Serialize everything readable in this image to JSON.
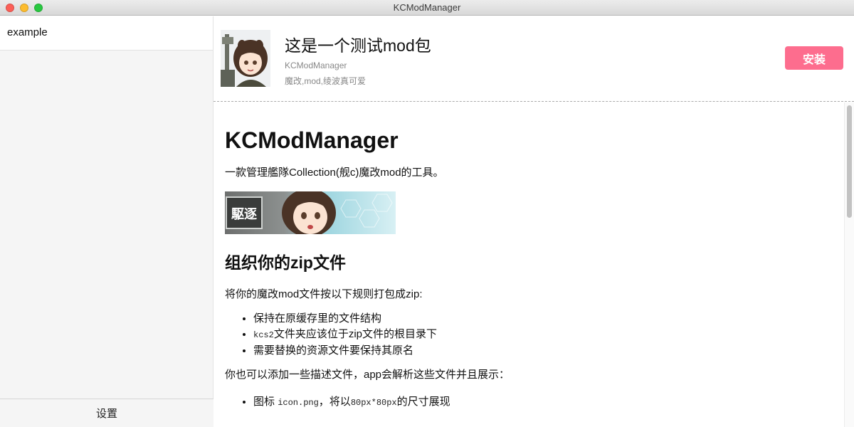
{
  "window": {
    "title": "KCModManager"
  },
  "sidebar": {
    "items": [
      {
        "label": "example"
      }
    ],
    "footer_label": "设置"
  },
  "mod": {
    "title": "这是一个测试mod包",
    "author": "KCModManager",
    "tags": "魔改,mod,绫波真可爱",
    "install_label": "安装",
    "install_color": "#fd6d8e"
  },
  "doc": {
    "h1": "KCModManager",
    "intro": "一款管理艦隊Collection(舰c)魔改mod的工具。",
    "banner_badge": "駆逐",
    "h2": "组织你的zip文件",
    "p_organize": "将你的魔改mod文件按以下规则打包成zip:",
    "rules": {
      "r1": "保持在原缓存里的文件结构",
      "r2_code": "kcs2",
      "r2_text": "文件夹应该位于zip文件的根目录下",
      "r3": "需要替换的资源文件要保持其原名"
    },
    "p_desc": "你也可以添加一些描述文件，app会解析这些文件并且展示：",
    "desc_items": {
      "d1_prefix": "图标",
      "d1_code1": "icon.png",
      "d1_mid": "，将以",
      "d1_code2": "80px*80px",
      "d1_suffix": "的尺寸展现"
    }
  },
  "colors": {
    "accent": "#fd6d8e",
    "sidebar_bg": "#f5f5f5"
  }
}
